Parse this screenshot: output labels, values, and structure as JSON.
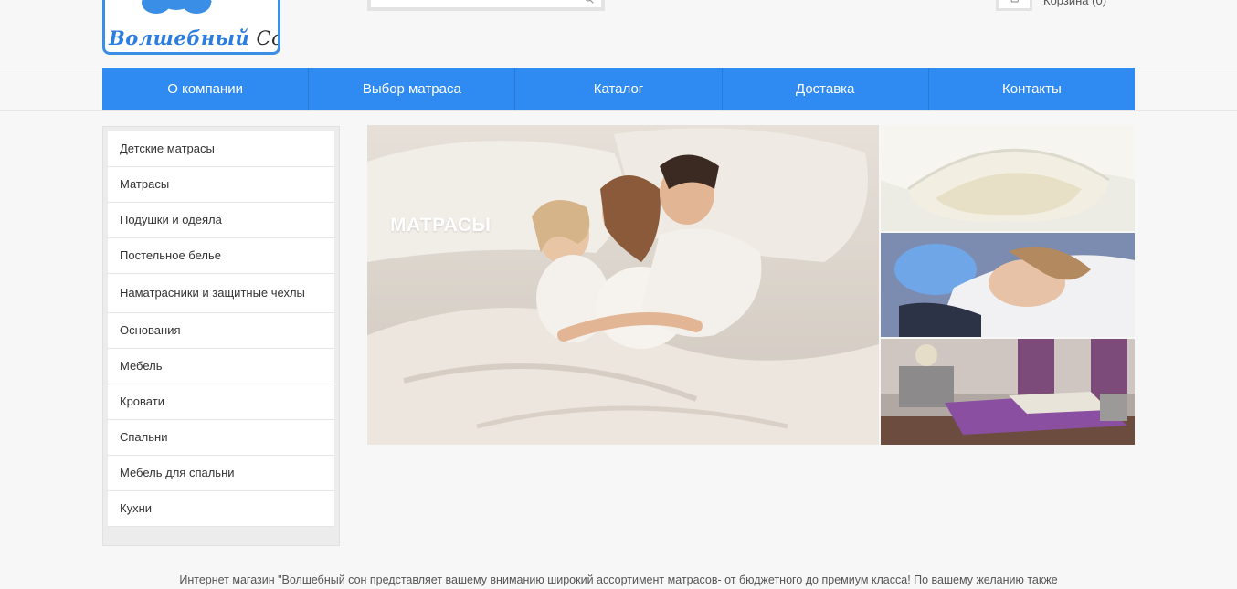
{
  "header": {
    "logo": {
      "word1": "Волшебный",
      "word2": "Сон"
    },
    "search": {
      "placeholder": ""
    },
    "cart": {
      "text": "Корзина (0)"
    }
  },
  "nav": {
    "items": [
      {
        "label": "О компании"
      },
      {
        "label": "Выбор матраса"
      },
      {
        "label": "Каталог"
      },
      {
        "label": "Доставка"
      },
      {
        "label": "Контакты"
      }
    ]
  },
  "sidebar": {
    "items": [
      {
        "label": "Детские матрасы"
      },
      {
        "label": "Матрасы"
      },
      {
        "label": "Подушки и одеяла"
      },
      {
        "label": "Постельное белье"
      },
      {
        "label": "Наматрасники и защитные чехлы"
      },
      {
        "label": "Основания"
      },
      {
        "label": "Мебель"
      },
      {
        "label": "Кровати"
      },
      {
        "label": "Спальни"
      },
      {
        "label": "Мебель для спальни"
      },
      {
        "label": "Кухни"
      }
    ]
  },
  "banner": {
    "title": "МАТРАСЫ"
  },
  "footer": {
    "intro": "Интернет магазин \"Волшебный сон представляет вашему вниманию широкий ассортимент матрасов- от бюджетного до премиум класса! По вашему желанию также"
  },
  "colors": {
    "accent": "#2f8af2",
    "logo_blue": "#2b7de0"
  }
}
